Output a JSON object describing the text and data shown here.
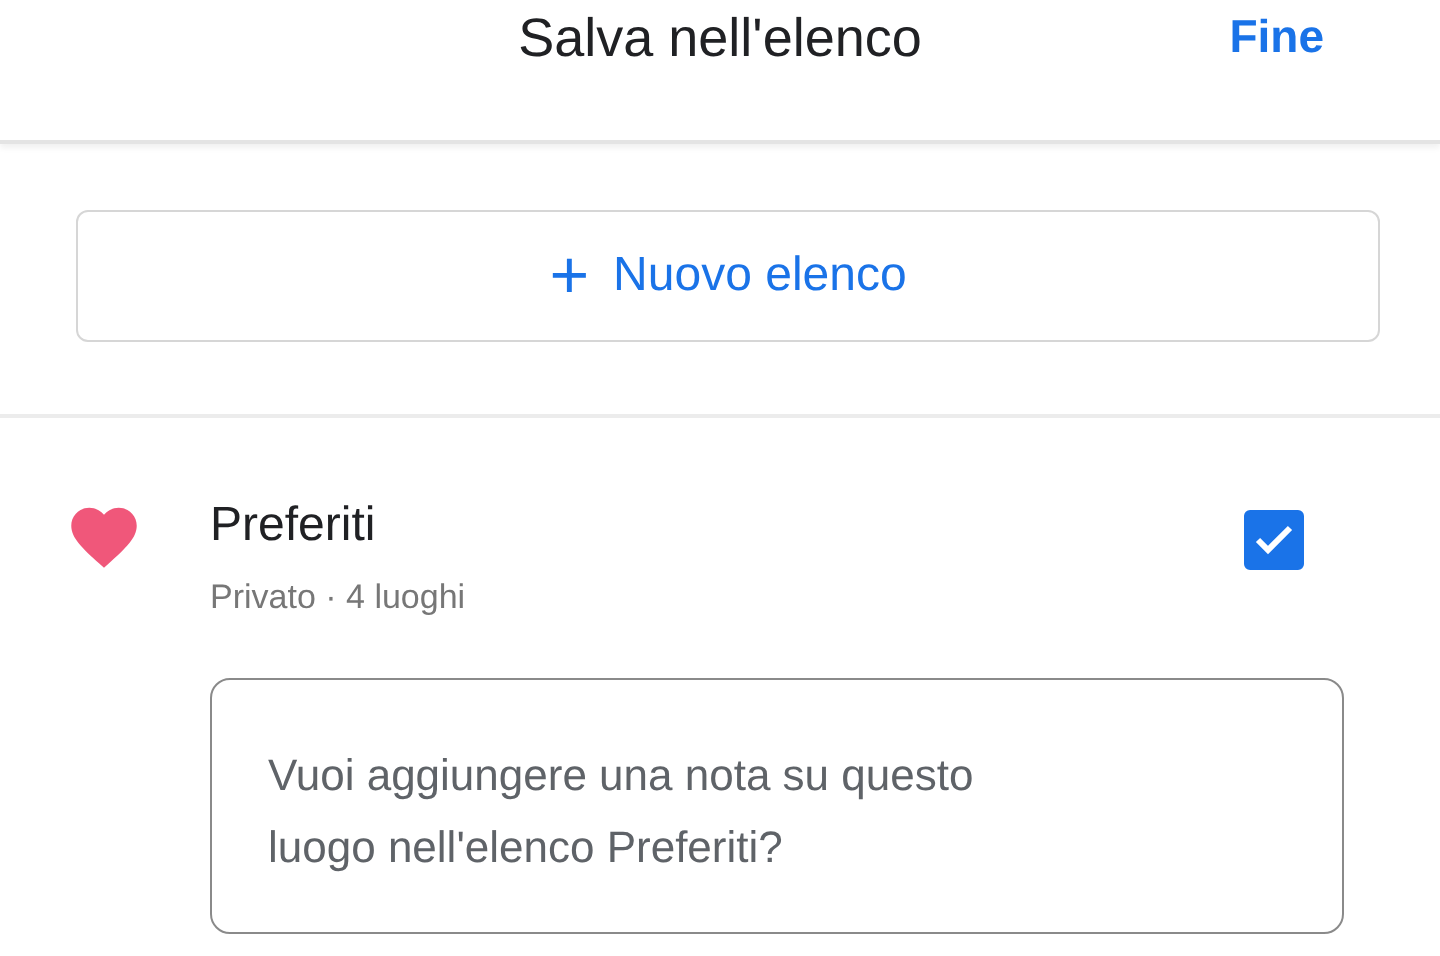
{
  "header": {
    "title": "Salva nell'elenco",
    "done": "Fine"
  },
  "new_list_button": {
    "icon": "+",
    "label": "Nuovo elenco"
  },
  "lists": [
    {
      "name": "Preferiti",
      "details": "Privato · 4 luoghi",
      "checked": true,
      "color": "#f0577a",
      "note": {
        "placeholder": "Vuoi aggiungere una nota su questo luogo nell'elenco Preferiti?"
      }
    }
  ]
}
